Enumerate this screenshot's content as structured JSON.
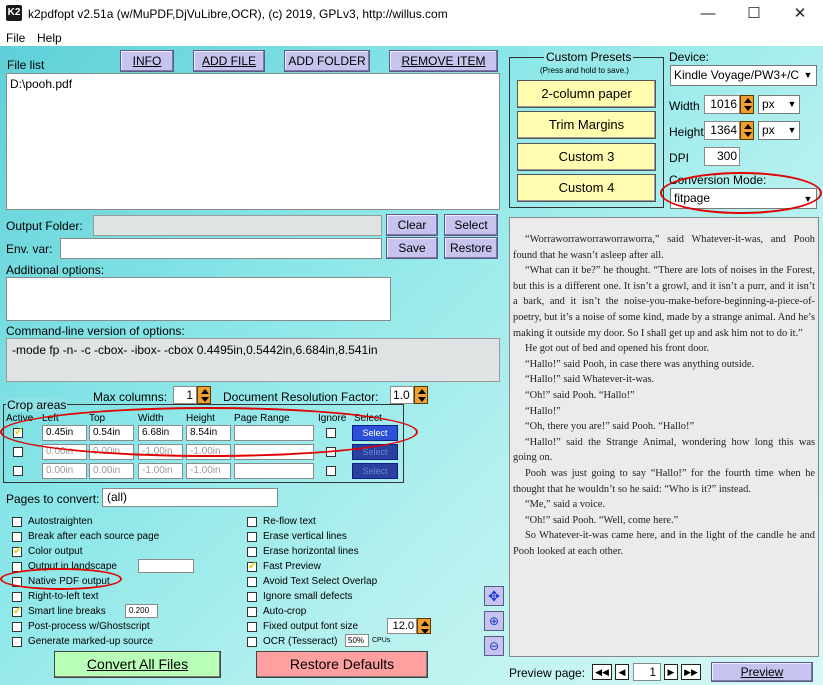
{
  "window": {
    "title": "k2pdfopt v2.51a (w/MuPDF,DjVuLibre,OCR), (c) 2019, GPLv3, http://willus.com",
    "icon_text": "K2"
  },
  "menu": [
    "File",
    "Help"
  ],
  "file_list": {
    "label": "File list",
    "items": [
      "D:\\pooh.pdf"
    ],
    "buttons": [
      "INFO",
      "ADD FILE",
      "ADD FOLDER",
      "REMOVE ITEM"
    ]
  },
  "output_folder": {
    "label": "Output Folder:",
    "value": "",
    "clear": "Clear",
    "select": "Select"
  },
  "env_var": {
    "label": "Env. var:",
    "value": "",
    "save": "Save",
    "restore": "Restore"
  },
  "additional_options": {
    "label": "Additional options:",
    "value": ""
  },
  "cmdline": {
    "label": "Command-line version of options:",
    "value": "-mode fp -n- -c -cbox- -ibox- -cbox 0.4495in,0.5442in,6.684in,8.541in"
  },
  "max_columns": {
    "label": "Max columns:",
    "value": "1"
  },
  "doc_res": {
    "label": "Document Resolution Factor:",
    "value": "1.0"
  },
  "crop": {
    "title": "Crop areas",
    "headers": [
      "Active",
      "Left",
      "Top",
      "Width",
      "Height",
      "Page Range",
      "Ignore",
      "Select"
    ],
    "rows": [
      {
        "left": "0.45in",
        "top": "0.54in",
        "width": "6.68in",
        "height": "8.54in",
        "range": "",
        "select": "Select"
      },
      {
        "left": "0.00in",
        "top": "0.00in",
        "width": "-1.00in",
        "height": "-1.00in",
        "range": "",
        "select": "Select"
      },
      {
        "left": "0.00in",
        "top": "0.00in",
        "width": "-1.00in",
        "height": "-1.00in",
        "range": "",
        "select": "Select"
      }
    ]
  },
  "pages": {
    "label": "Pages to convert:",
    "value": "(all)"
  },
  "options_left": [
    "Autostraighten",
    "Break after each source page",
    "Color output",
    "Output in landscape",
    "Native PDF output",
    "Right-to-left text",
    "Smart line breaks",
    "Post-process w/Ghostscript",
    "Generate marked-up source"
  ],
  "options_right": [
    "Re-flow text",
    "Erase vertical lines",
    "Erase horizontal lines",
    "Fast Preview",
    "Avoid Text Select Overlap",
    "Ignore small defects",
    "Auto-crop",
    "Fixed output font size",
    "OCR (Tesseract)"
  ],
  "smart_breaks_value": "0.200",
  "font_size_value": "12.0",
  "ocr_value": "50%",
  "ocr_unit": "CPUs",
  "convert_btn": "Convert All Files",
  "restore_defaults_btn": "Restore Defaults",
  "presets": {
    "title": "Custom Presets",
    "subtitle": "(Press and hold to save.)",
    "buttons": [
      "2-column paper",
      "Trim Margins",
      "Custom 3",
      "Custom 4"
    ]
  },
  "device": {
    "label": "Device:",
    "value": "Kindle Voyage/PW3+/C",
    "width_label": "Width",
    "width": "1016",
    "width_unit": "px",
    "height_label": "Height",
    "height": "1364",
    "height_unit": "px",
    "dpi_label": "DPI",
    "dpi": "300"
  },
  "conversion_mode": {
    "label": "Conversion Mode:",
    "value": "fitpage"
  },
  "preview": {
    "label": "Preview page:",
    "page": "1",
    "button": "Preview"
  },
  "book_text": [
    "“Worraworraworraworraworra,” said Whatever-it-was, and Pooh found that he wasn’t asleep after all.",
    "“What can it be?” he thought. “There are lots of noises in the Forest, but this is a different one. It isn’t a growl, and it isn’t a purr, and it isn’t a bark, and it isn’t the noise-you-make-before-beginning-a-piece-of-poetry, but it’s a noise of some kind, made by a strange animal. And he’s making it outside my door. So I shall get up and ask him not to do it.”",
    "He got out of bed and opened his front door.",
    "“Hallo!” said Pooh, in case there was anything outside.",
    "“Hallo!” said Whatever-it-was.",
    "“Oh!” said Pooh. “Hallo!”",
    "“Hallo!”",
    "“Oh, there you are!” said Pooh. “Hallo!”",
    "“Hallo!” said the Strange Animal, wondering how long this was going on.",
    "Pooh was just going to say “Hallo!” for the fourth time when he thought that he wouldn’t so he said: “Who is it?” instead.",
    "“Me,” said a voice.",
    "“Oh!” said Pooh. “Well, come here.”",
    "So Whatever-it-was came here, and in the light of the candle he and Pooh looked at each other."
  ]
}
